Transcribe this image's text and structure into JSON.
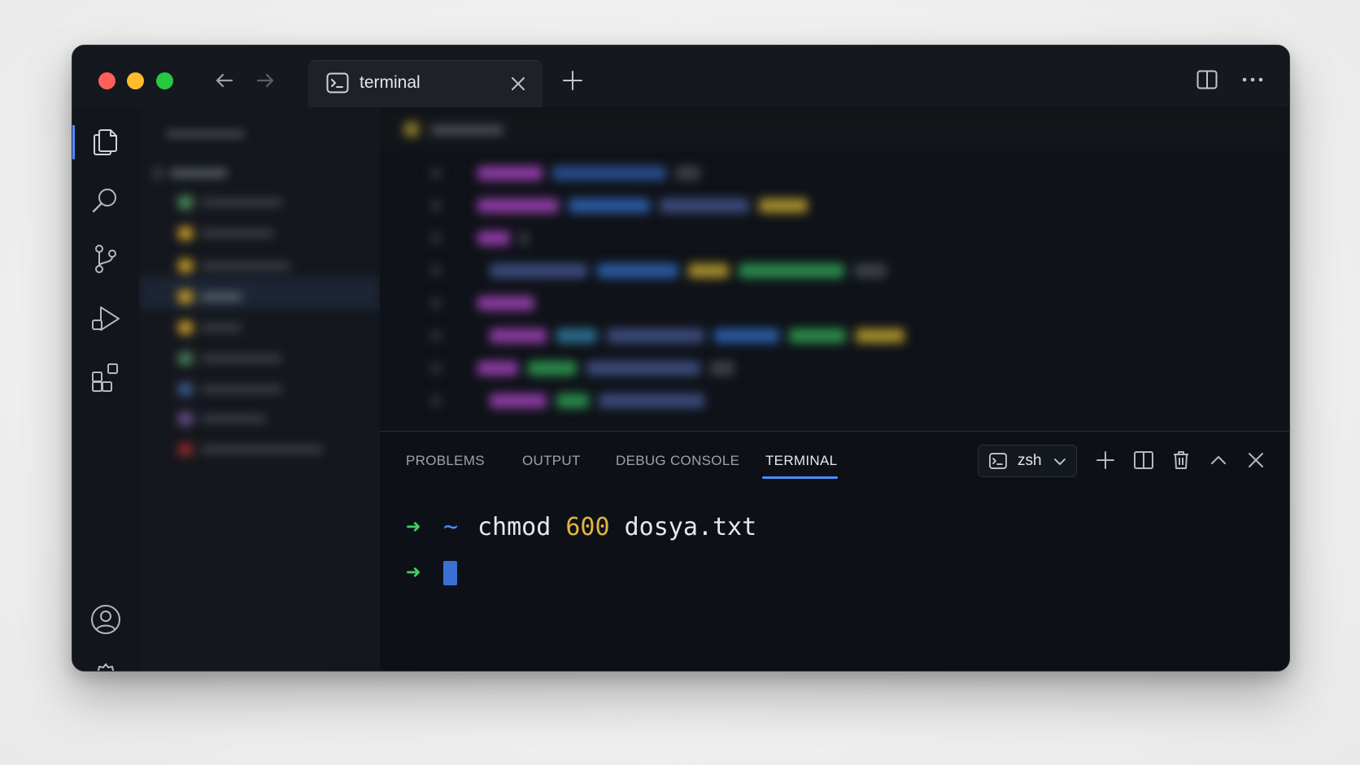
{
  "window": {
    "tab": {
      "label": "terminal"
    },
    "icons": {
      "back": "arrow-left-icon",
      "forward": "arrow-right-icon",
      "tab": "terminal-icon",
      "close": "close-icon",
      "add": "plus-icon",
      "split": "split-layout-icon",
      "more": "more-icon"
    }
  },
  "activity_bar": {
    "items": [
      "files-icon",
      "search-icon",
      "source-control-icon",
      "run-debug-icon",
      "extensions-icon",
      "account-icon",
      "settings-icon"
    ]
  },
  "panel": {
    "tabs": [
      "PROBLEMS",
      "OUTPUT",
      "DEBUG CONSOLE",
      "TERMINAL"
    ],
    "active_tab": "TERMINAL",
    "shell": "zsh"
  },
  "terminal": {
    "prompt_symbol": "➜",
    "cwd": "~",
    "command_name": "chmod",
    "command_mode": "600",
    "command_file": "dosya.txt"
  },
  "colors": {
    "accent": "#4e8cff",
    "prompt": "#3fcf5e",
    "number": "#e3b341",
    "background": "#0d1117"
  }
}
